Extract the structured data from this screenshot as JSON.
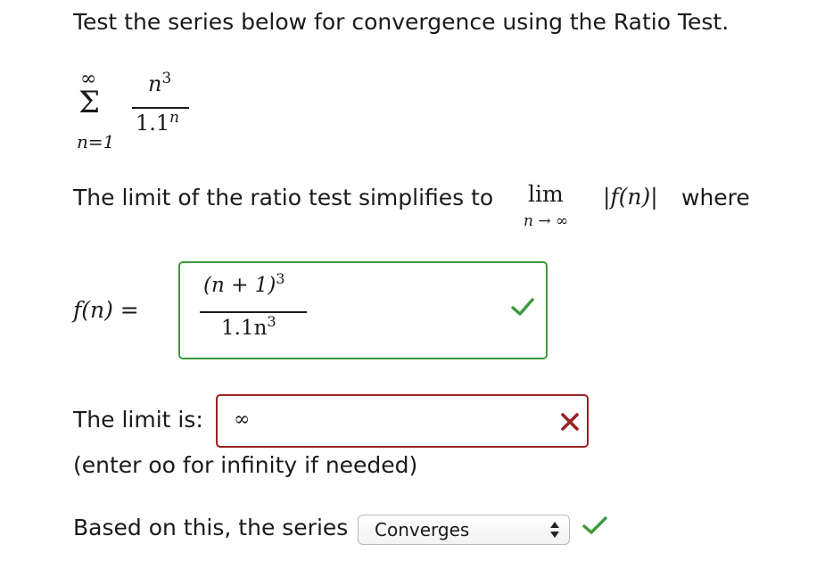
{
  "prompt": "Test the series below for convergence using the Ratio Test.",
  "series": {
    "sigma": "Σ",
    "upper": "∞",
    "lower": "n=1",
    "numerator_base": "n",
    "numerator_exp": "3",
    "denominator_base": "1.1",
    "denominator_exp": "n"
  },
  "ratio": {
    "text": "The limit of the ratio test simplifies to",
    "lim": "lim",
    "lim_sub": "n → ∞",
    "abs_fn": "|f(n)|",
    "where": "where"
  },
  "fn_label": "f(n) =",
  "fn_answer": {
    "numerator": "(n + 1)",
    "numerator_exp": "3",
    "denominator": "1.1n",
    "denominator_exp": "3",
    "status": "correct"
  },
  "limit": {
    "label": "The limit is:",
    "value": "∞",
    "status": "incorrect"
  },
  "hint": "(enter oo for infinity if needed)",
  "conclusion": {
    "label": "Based on this, the series",
    "selected": "Converges",
    "status": "correct"
  },
  "colors": {
    "correct": "#3b9a3b",
    "incorrect": "#9a2222"
  },
  "icons": {
    "correct": "check-icon",
    "incorrect": "x-icon",
    "select": "up-down-arrows-icon"
  }
}
